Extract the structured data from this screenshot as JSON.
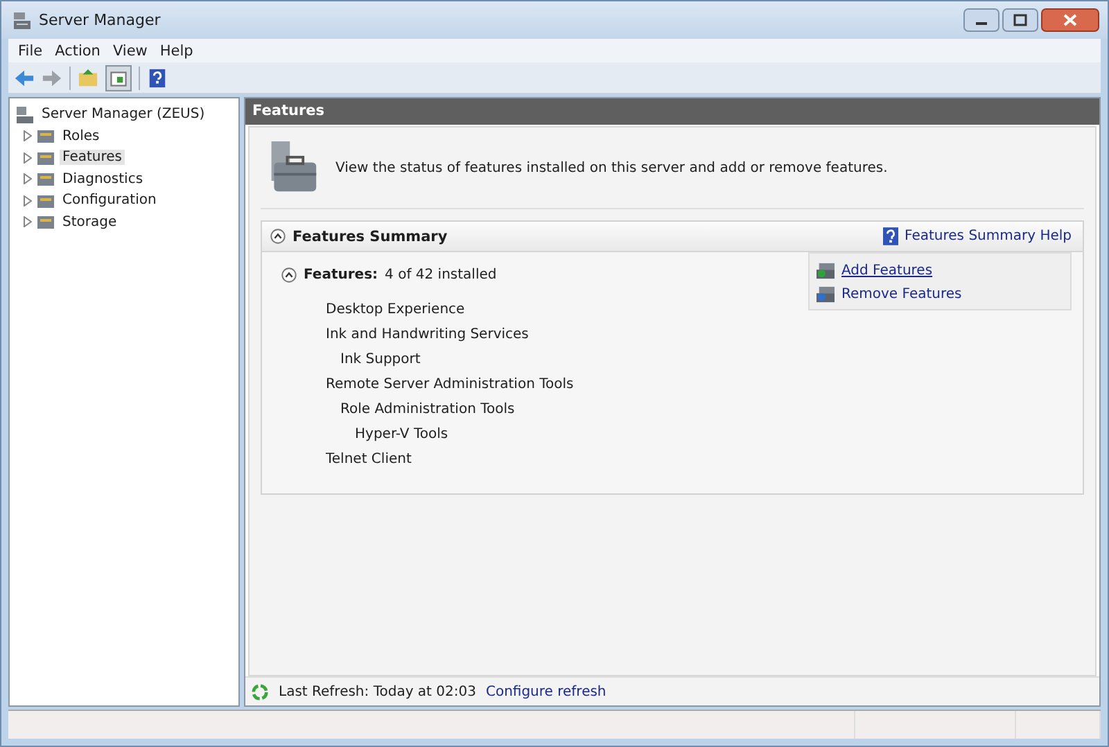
{
  "window": {
    "title": "Server Manager"
  },
  "menu": [
    "File",
    "Action",
    "View",
    "Help"
  ],
  "tree": {
    "root": "Server Manager (ZEUS)",
    "items": [
      {
        "label": "Roles",
        "selected": false
      },
      {
        "label": "Features",
        "selected": true
      },
      {
        "label": "Diagnostics",
        "selected": false
      },
      {
        "label": "Configuration",
        "selected": false
      },
      {
        "label": "Storage",
        "selected": false
      }
    ]
  },
  "main": {
    "header": "Features",
    "description": "View the status of features installed on this server and add or remove features.",
    "summary": {
      "title": "Features Summary",
      "help_link": "Features Summary Help",
      "features_label": "Features:",
      "features_count": "4 of 42 installed",
      "features": [
        {
          "label": "Desktop Experience"
        },
        {
          "label": "Ink and Handwriting Services",
          "children": [
            {
              "label": "Ink Support"
            }
          ]
        },
        {
          "label": "Remote Server Administration Tools",
          "children": [
            {
              "label": "Role Administration Tools",
              "children": [
                {
                  "label": "Hyper-V Tools"
                }
              ]
            }
          ]
        },
        {
          "label": "Telnet Client"
        }
      ],
      "actions": [
        "Add Features",
        "Remove Features"
      ]
    },
    "footer": {
      "last_refresh": "Last Refresh: Today at 02:03",
      "configure_link": "Configure refresh"
    }
  }
}
